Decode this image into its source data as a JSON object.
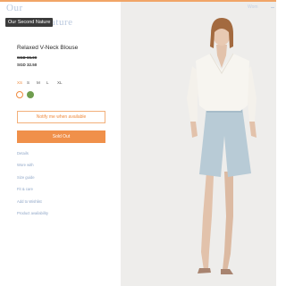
{
  "header": {
    "logo_word_1": "Our",
    "logo_word_2": "ature",
    "tooltip": "Our Second Nature",
    "nav_label": "Wom"
  },
  "product": {
    "title": "Relaxed V-Neck Blouse",
    "price_old": "SGD 65.00",
    "price_new": "SGD 32.50"
  },
  "sizes": [
    "XS",
    "S",
    "M",
    "L",
    "XL"
  ],
  "selected_size": "XS",
  "colors": [
    {
      "name": "cream",
      "hex": "#ffffff"
    },
    {
      "name": "green",
      "hex": "#6f9d4e"
    }
  ],
  "buttons": {
    "notify": "Notify me when available",
    "sold_out": "Sold Out"
  },
  "links": [
    "Details",
    "Wore with",
    "Size guide",
    "Fit & care",
    "Add to Wishlist",
    "Product availability"
  ],
  "accent_color": "#f0904a"
}
